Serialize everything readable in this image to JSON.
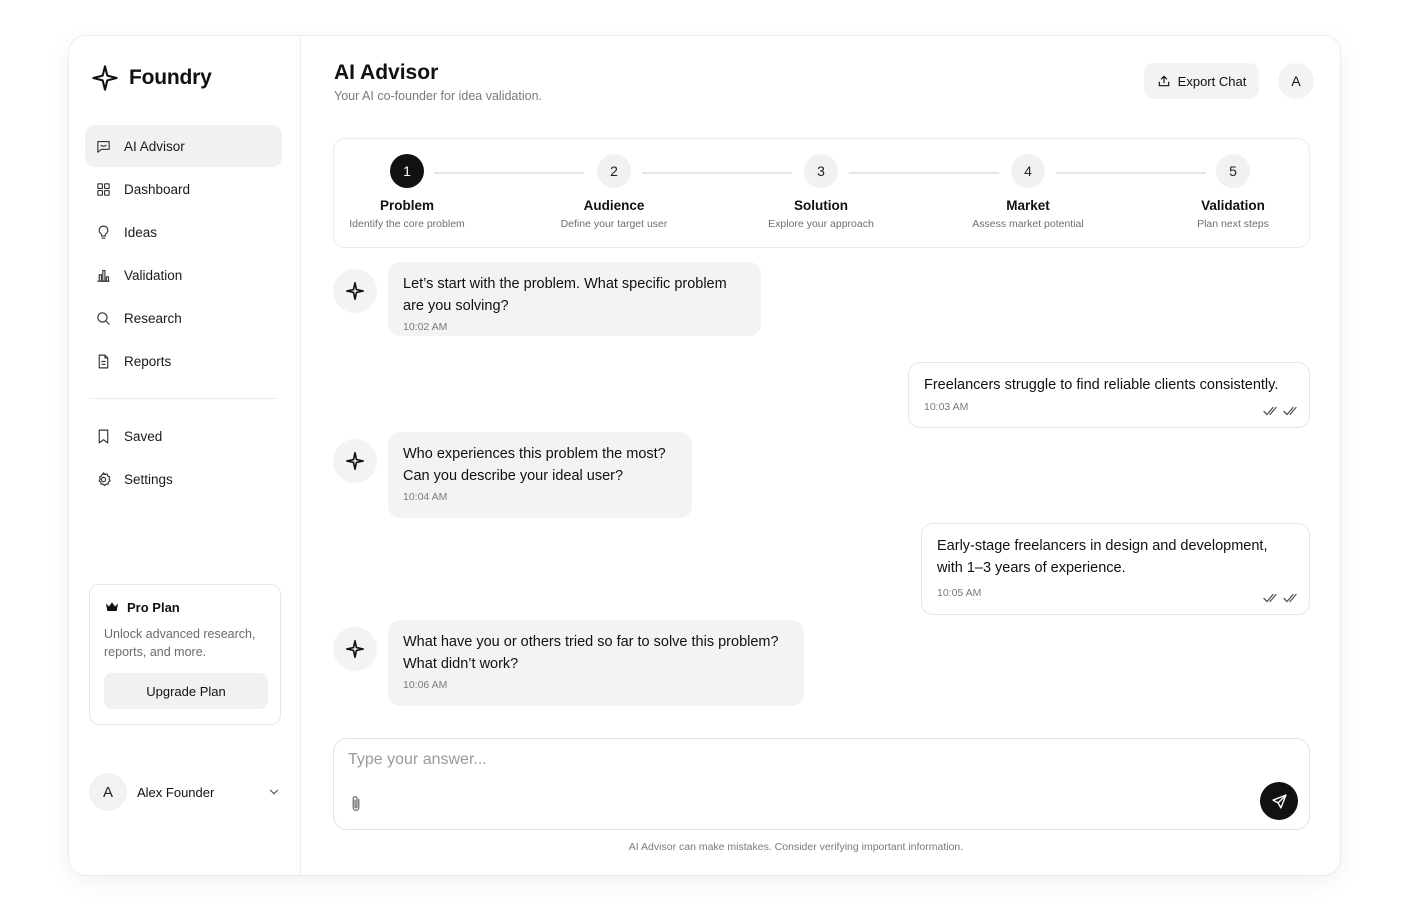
{
  "brand": {
    "name": "Foundry",
    "icon": "sparkle-icon"
  },
  "sidebar": {
    "items": [
      {
        "label": "AI Advisor",
        "icon": "chat-icon",
        "active": true
      },
      {
        "label": "Dashboard",
        "icon": "grid-icon",
        "active": false
      },
      {
        "label": "Ideas",
        "icon": "lightbulb-icon",
        "active": false
      },
      {
        "label": "Validation",
        "icon": "bar-chart-icon",
        "active": false
      },
      {
        "label": "Research",
        "icon": "search-icon",
        "active": false
      },
      {
        "label": "Reports",
        "icon": "document-icon",
        "active": false
      }
    ],
    "secondary": [
      {
        "label": "Saved",
        "icon": "bookmark-icon"
      },
      {
        "label": "Settings",
        "icon": "gear-icon"
      }
    ],
    "pro_plan": {
      "title": "Pro Plan",
      "description": "Unlock advanced research, reports, and more.",
      "button": "Upgrade Plan"
    },
    "user": {
      "initial": "A",
      "name": "Alex Founder"
    }
  },
  "header": {
    "title": "AI Advisor",
    "subtitle": "Your AI co-founder for idea validation.",
    "export_label": "Export Chat",
    "avatar_initial": "A"
  },
  "steps": [
    {
      "num": "1",
      "title": "Problem",
      "desc": "Identify the core problem",
      "active": true
    },
    {
      "num": "2",
      "title": "Audience",
      "desc": "Define your target user",
      "active": false
    },
    {
      "num": "3",
      "title": "Solution",
      "desc": "Explore your approach",
      "active": false
    },
    {
      "num": "4",
      "title": "Market",
      "desc": "Assess market potential",
      "active": false
    },
    {
      "num": "5",
      "title": "Validation",
      "desc": "Plan next steps",
      "active": false
    }
  ],
  "messages": [
    {
      "role": "ai",
      "text": "Let’s start with the problem. What specific problem are you solving?",
      "time": "10:02 AM"
    },
    {
      "role": "user",
      "text": "Freelancers struggle to find reliable clients consistently.",
      "time": "10:03 AM"
    },
    {
      "role": "ai",
      "text": "Who experiences this problem the most? Can you describe your ideal user?",
      "time": "10:04 AM"
    },
    {
      "role": "user",
      "text": "Early-stage freelancers in design and development, with 1–3 years of experience.",
      "time": "10:05 AM"
    },
    {
      "role": "ai",
      "text": "What have you or others tried so far to solve this problem? What didn’t work?",
      "time": "10:06 AM"
    }
  ],
  "composer": {
    "placeholder": "Type your answer..."
  },
  "disclaimer": "AI Advisor can make mistakes. Consider verifying important information."
}
